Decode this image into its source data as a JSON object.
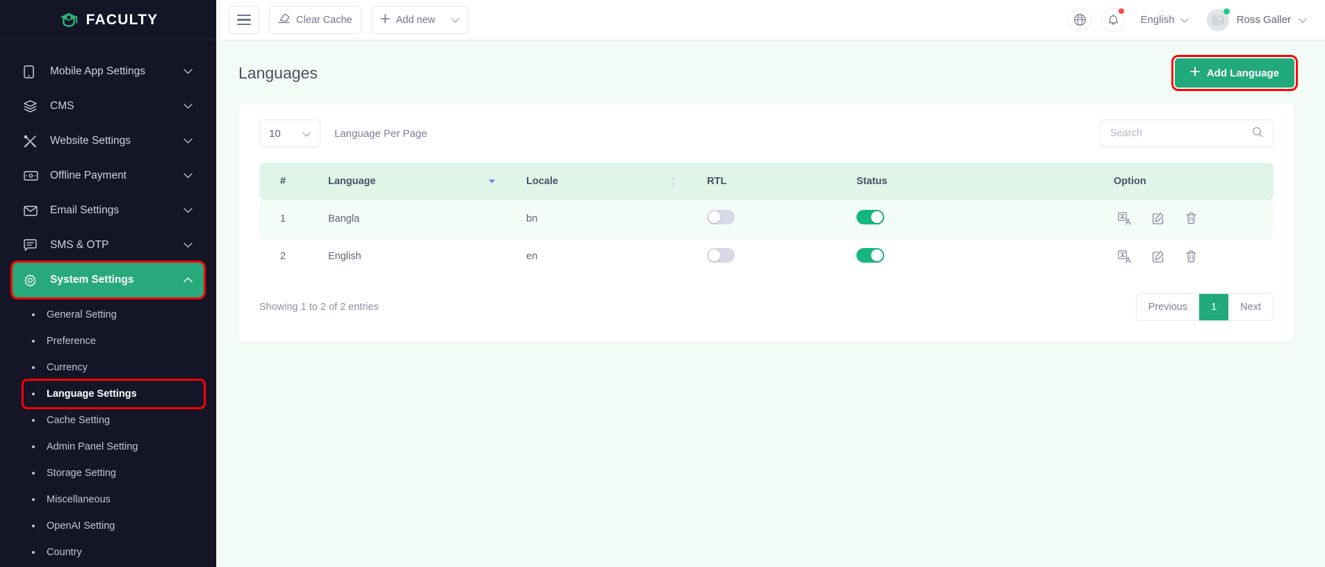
{
  "brand": {
    "name": "FACULTY",
    "accent": "#2bb47c"
  },
  "topbar": {
    "clear_cache_label": "Clear Cache",
    "add_new_label": "Add new",
    "language_label": "English",
    "user_name": "Ross Galler",
    "notification_badge_color": "#ff4d3d",
    "online_badge_color": "#1ecb84"
  },
  "sidebar": {
    "items": [
      {
        "label": "Mobile App Settings",
        "icon": "mobile-icon",
        "expandable": true
      },
      {
        "label": "CMS",
        "icon": "layers-icon",
        "expandable": true
      },
      {
        "label": "Website Settings",
        "icon": "tools-icon",
        "expandable": true
      },
      {
        "label": "Offline Payment",
        "icon": "cash-icon",
        "expandable": true
      },
      {
        "label": "Email Settings",
        "icon": "envelope-icon",
        "expandable": true
      },
      {
        "label": "SMS & OTP",
        "icon": "chat-icon",
        "expandable": true
      },
      {
        "label": "System Settings",
        "icon": "gear-icon",
        "expandable": true,
        "active": true,
        "highlighted": true
      }
    ],
    "sub_items": [
      {
        "label": "General Setting"
      },
      {
        "label": "Preference"
      },
      {
        "label": "Currency"
      },
      {
        "label": "Language Settings",
        "selected": true,
        "highlighted": true
      },
      {
        "label": "Cache Setting"
      },
      {
        "label": "Admin Panel Setting"
      },
      {
        "label": "Storage Setting"
      },
      {
        "label": "Miscellaneous"
      },
      {
        "label": "OpenAI Setting"
      },
      {
        "label": "Country"
      }
    ]
  },
  "page": {
    "title": "Languages",
    "add_language_label": "Add Language",
    "add_language_color": "#22a97c"
  },
  "table_controls": {
    "per_page_value": "10",
    "per_page_label": "Language Per Page",
    "search_value": "",
    "search_placeholder": "Search"
  },
  "table": {
    "columns": [
      {
        "label": "#",
        "sortable": false
      },
      {
        "label": "Language",
        "sortable": true,
        "sort_state": "desc"
      },
      {
        "label": "Locale",
        "sortable": true,
        "sort_state": "none"
      },
      {
        "label": "RTL",
        "sortable": false
      },
      {
        "label": "Status",
        "sortable": false
      },
      {
        "label": "Option",
        "sortable": false
      }
    ],
    "rows": [
      {
        "num": "1",
        "language": "Bangla",
        "locale": "bn",
        "rtl": false,
        "status": true,
        "options": [
          "translate-icon",
          "edit-icon",
          "delete-icon"
        ]
      },
      {
        "num": "2",
        "language": "English",
        "locale": "en",
        "rtl": false,
        "status": true,
        "options": [
          "translate-icon",
          "edit-icon",
          "delete-icon"
        ]
      }
    ]
  },
  "footer": {
    "entries_text": "Showing 1 to 2 of 2 entries",
    "previous_label": "Previous",
    "current_page": "1",
    "next_label": "Next"
  }
}
